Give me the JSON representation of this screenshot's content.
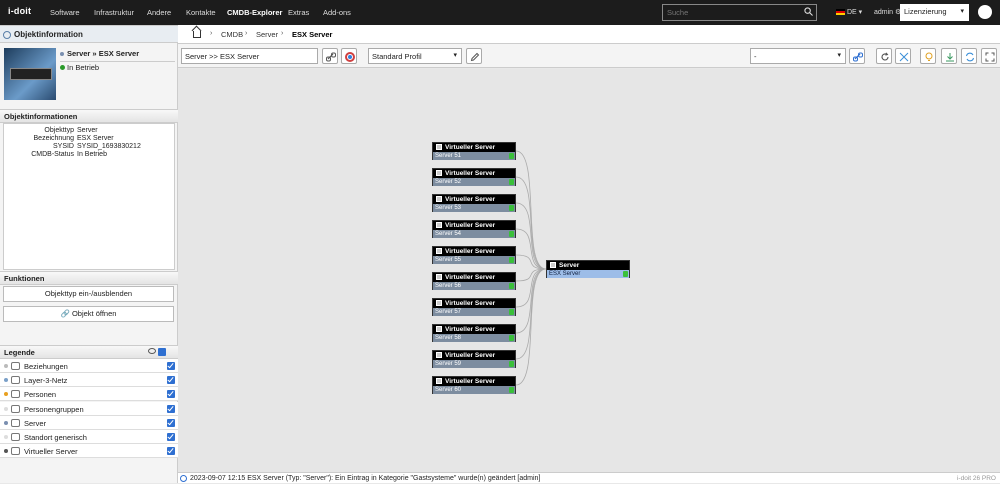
{
  "topnav": {
    "logo": "i-doit",
    "items": [
      "Software",
      "Infrastruktur",
      "Andere",
      "Kontakte",
      "CMDB-Explorer",
      "Extras",
      "Add-ons"
    ],
    "active": "CMDB-Explorer",
    "search_placeholder": "Suche",
    "language": "DE",
    "user": "admin",
    "tenant": "Lizenzierung"
  },
  "sidebar": {
    "objinfo_title": "Objektinformation",
    "object_title": "Server » ESX Server",
    "object_status": "In Betrieb",
    "info_head": "Objektinformationen",
    "info_rows": [
      {
        "k": "Objekttyp",
        "v": "Server"
      },
      {
        "k": "Bezeichnung",
        "v": "ESX Server"
      },
      {
        "k": "SYSID",
        "v": "SYSID_1693830212"
      },
      {
        "k": "CMDB-Status",
        "v": "In Betrieb"
      }
    ],
    "functions_head": "Funktionen",
    "functions": [
      "Objekttyp ein-/ausblenden",
      "Objekt öffnen"
    ],
    "legend_head": "Legende",
    "legend": [
      {
        "label": "Beziehungen",
        "dot": "#bbbbbb",
        "icon": "relations-icon"
      },
      {
        "label": "Layer-3-Netz",
        "dot": "#7aa0c8",
        "icon": "network-icon"
      },
      {
        "label": "Personen",
        "dot": "#e8a020",
        "icon": "person-icon"
      },
      {
        "label": "Personengruppen",
        "dot": "#dddddd",
        "icon": "group-icon"
      },
      {
        "label": "Server",
        "dot": "#7a8fb0",
        "icon": "server-icon"
      },
      {
        "label": "Standort generisch",
        "dot": "#dddddd",
        "icon": "location-icon"
      },
      {
        "label": "Virtueller Server",
        "dot": "#555555",
        "icon": "virtual-server-icon"
      }
    ]
  },
  "breadcrumb": [
    "CMDB",
    "Server",
    "ESX Server"
  ],
  "toolbar": {
    "path": "Server >> ESX Server",
    "profile": "Standard Profil",
    "right_select": "-"
  },
  "graph": {
    "children_type": "Virtueller Server",
    "children": [
      "Server 51",
      "Server 52",
      "Server 53",
      "Server 54",
      "Server 55",
      "Server 56",
      "Server 57",
      "Server 58",
      "Server 59",
      "Server 60"
    ],
    "main_type": "Server",
    "main_name": "ESX Server"
  },
  "status": {
    "message": "2023-09-07 12:15 ESX Server (Typ: \"Server\"): Ein Eintrag in Kategorie \"Gastsysteme\" wurde(n) geändert [admin]",
    "version": "i-doit 26 PRO"
  }
}
